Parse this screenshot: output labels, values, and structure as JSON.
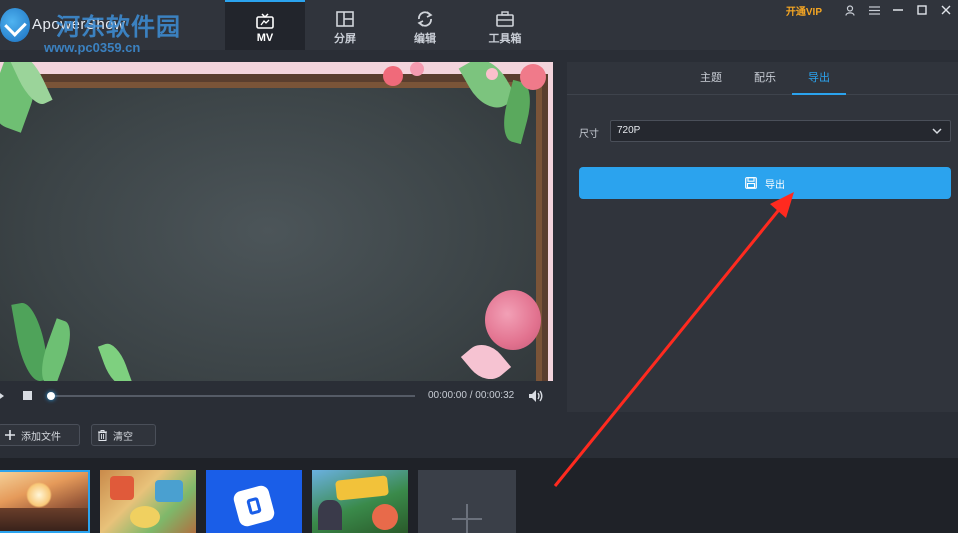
{
  "app": {
    "name": "ApowerShow",
    "watermark_title": "河东软件园",
    "watermark_url": "www.pc0359.cn"
  },
  "tabs": [
    {
      "label": "MV",
      "icon": "tv-icon",
      "active": true
    },
    {
      "label": "分屏",
      "icon": "split-screen-icon",
      "active": false
    },
    {
      "label": "编辑",
      "icon": "refresh-icon",
      "active": false
    },
    {
      "label": "工具箱",
      "icon": "toolbox-icon",
      "active": false
    }
  ],
  "window": {
    "vip_label": "开通VIP",
    "icons": [
      "user-icon",
      "menu-icon",
      "minimize-icon",
      "maximize-icon",
      "close-icon"
    ]
  },
  "player": {
    "time": "00:00:00 / 00:00:32",
    "progress": 0
  },
  "panel": {
    "tabs": [
      "主题",
      "配乐",
      "导出"
    ],
    "active_tab": "导出",
    "size_label": "尺寸",
    "size_value": "720P",
    "export_label": "导出"
  },
  "toolbar": {
    "add_file_label": "添加文件",
    "clear_label": "清空"
  },
  "media": {
    "thumbnails": [
      "sunset-scene",
      "game-characters",
      "blue-app-logo",
      "game-poster"
    ]
  },
  "colors": {
    "accent": "#2ba3ee",
    "vip": "#f5a623",
    "annotation_arrow": "#ff2a1f"
  }
}
